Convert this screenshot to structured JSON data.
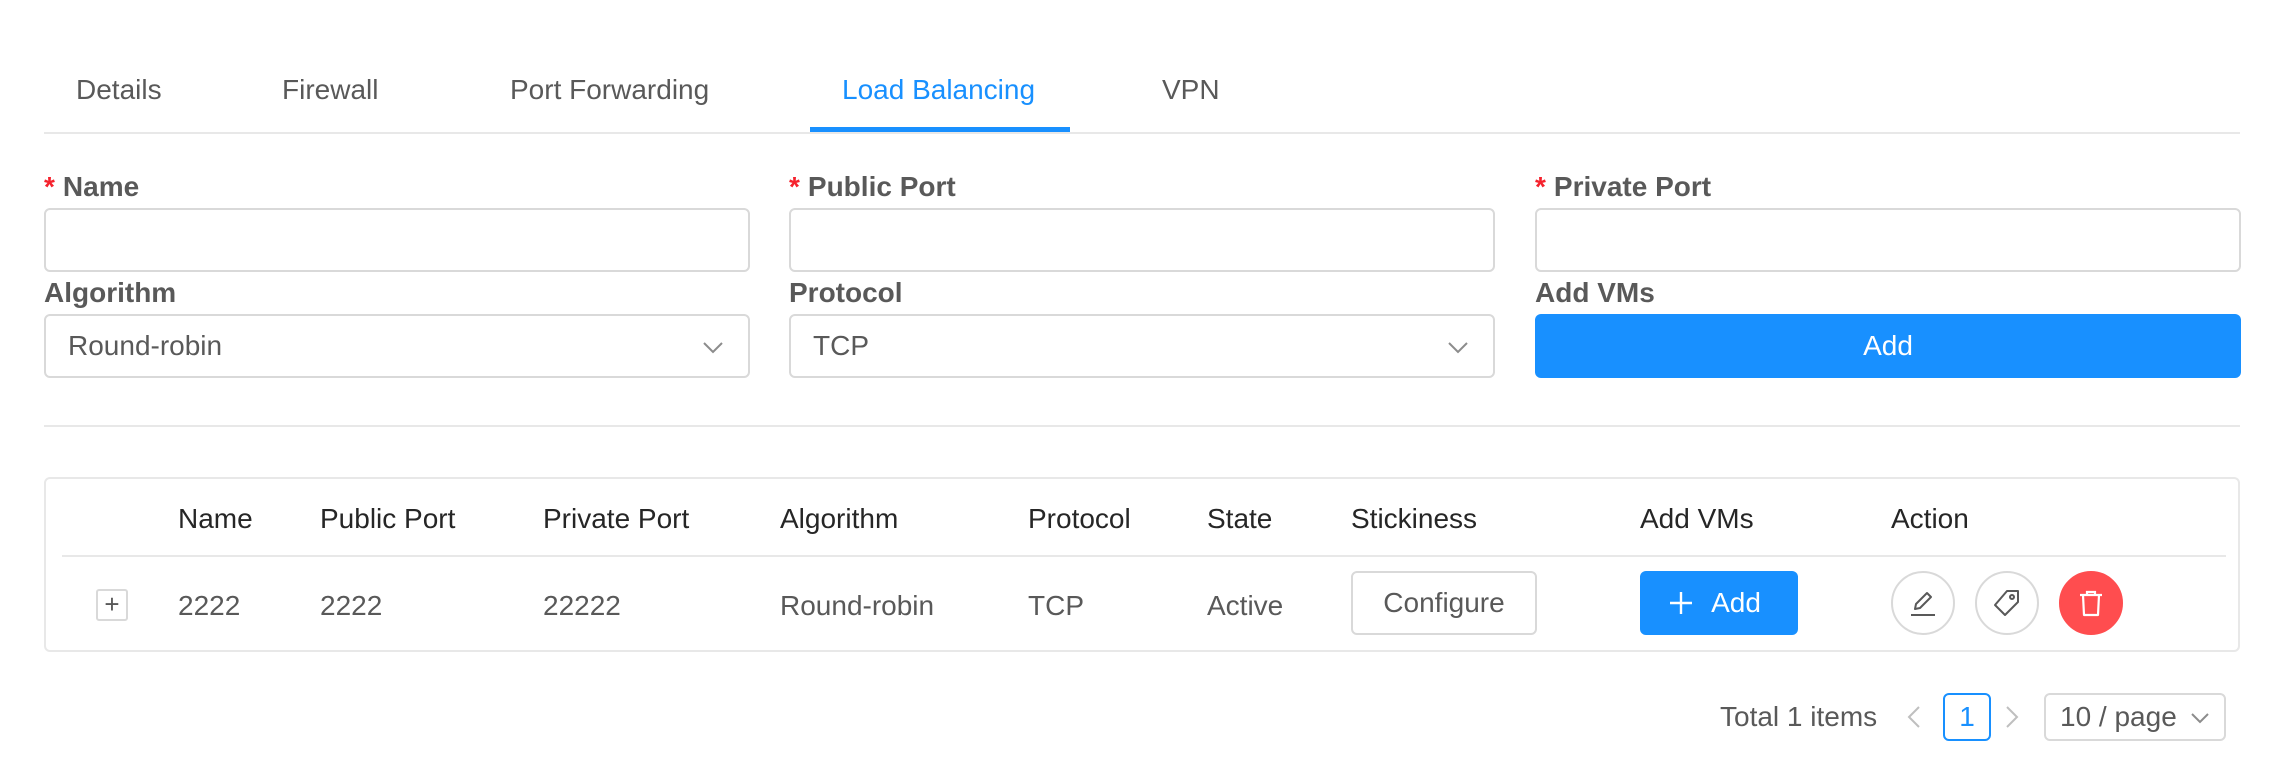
{
  "tabs": [
    {
      "label": "Details"
    },
    {
      "label": "Firewall"
    },
    {
      "label": "Port Forwarding"
    },
    {
      "label": "Load Balancing",
      "active": true
    },
    {
      "label": "VPN"
    }
  ],
  "form": {
    "name_label": "Name",
    "name_value": "",
    "public_port_label": "Public Port",
    "public_port_value": "",
    "private_port_label": "Private Port",
    "private_port_value": "",
    "required_mark": "*",
    "algorithm_label": "Algorithm",
    "algorithm_value": "Round-robin",
    "protocol_label": "Protocol",
    "protocol_value": "TCP",
    "add_vms_label": "Add VMs",
    "add_button": "Add"
  },
  "table": {
    "columns": [
      "Name",
      "Public Port",
      "Private Port",
      "Algorithm",
      "Protocol",
      "State",
      "Stickiness",
      "Add VMs",
      "Action"
    ],
    "rows": [
      {
        "expand": "+",
        "name": "2222",
        "public_port": "2222",
        "private_port": "22222",
        "algorithm": "Round-robin",
        "protocol": "TCP",
        "state": "Active",
        "stickiness_button": "Configure",
        "add_vms_button": "Add",
        "actions": [
          "edit-icon",
          "tag-icon",
          "delete-icon"
        ]
      }
    ]
  },
  "pagination": {
    "total": "Total 1 items",
    "current_page": "1",
    "page_size": "10 / page"
  },
  "colors": {
    "primary": "#1890ff",
    "danger": "#ff4d4f",
    "required": "#f5222d"
  }
}
